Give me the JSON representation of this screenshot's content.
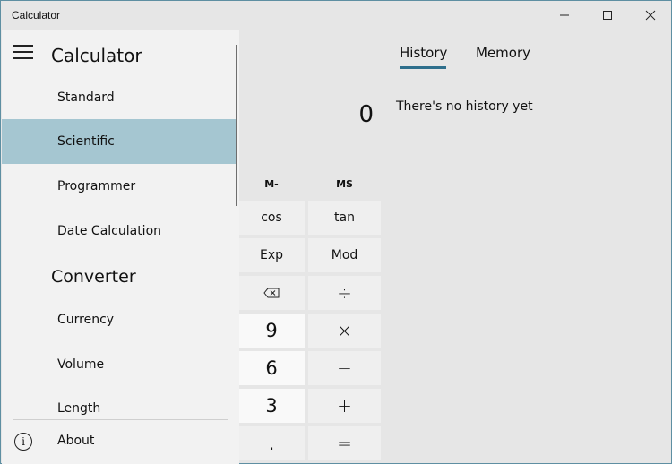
{
  "window": {
    "title": "Calculator",
    "controls": {
      "minimize": "minimize",
      "maximize": "maximize",
      "close": "close"
    }
  },
  "nav": {
    "title": "Calculator",
    "menu_icon": "hamburger-icon",
    "calculator_items": [
      {
        "label": "Standard",
        "selected": false
      },
      {
        "label": "Scientific",
        "selected": true
      },
      {
        "label": "Programmer",
        "selected": false
      },
      {
        "label": "Date Calculation",
        "selected": false
      }
    ],
    "converter_section": "Converter",
    "converter_items": [
      {
        "label": "Currency"
      },
      {
        "label": "Volume"
      },
      {
        "label": "Length"
      }
    ],
    "about": {
      "label": "About",
      "icon": "info-icon"
    },
    "selected_color": "#a5c6d1"
  },
  "display": {
    "value": "0"
  },
  "history_panel": {
    "tabs": [
      {
        "label": "History",
        "active": true
      },
      {
        "label": "Memory",
        "active": false
      }
    ],
    "empty_message": "There's no history yet",
    "accent": "#2e6f8c"
  },
  "memory_buttons": [
    "M-",
    "MS"
  ],
  "keys": [
    [
      "cos",
      "tan"
    ],
    [
      "Exp",
      "Mod"
    ],
    [
      "⌫",
      "÷"
    ],
    [
      "9",
      "×"
    ],
    [
      "6",
      "−"
    ],
    [
      "3",
      "+"
    ],
    [
      ".",
      "="
    ]
  ]
}
